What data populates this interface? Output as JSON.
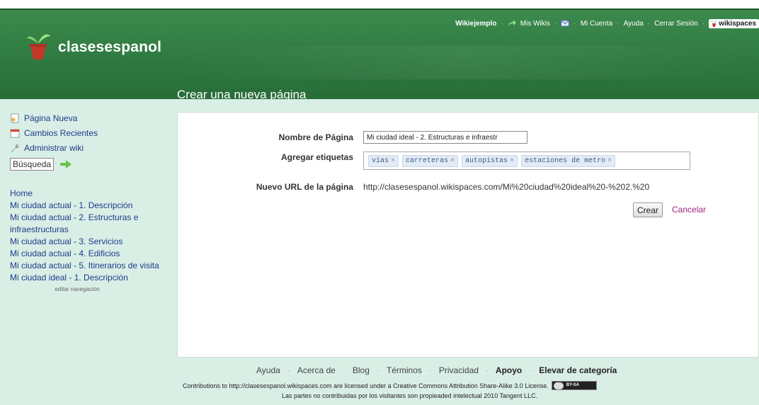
{
  "header": {
    "wiki_name": "clasesespanol",
    "page_title": "Crear una nueva página",
    "topnav": {
      "user": "Wikiejemplo",
      "my_wikis": "Mis Wikis",
      "my_account": "Mi Cuenta",
      "help": "Ayuda",
      "logout": "Cerrar Sesión",
      "brand": "wikispaces"
    },
    "colors": {
      "header_green": "#2f7a40",
      "band": "#d9efe6",
      "link_blue": "#1f3a8a",
      "cancel_purple": "#a0207e"
    }
  },
  "sidebar": {
    "new_page": "Página Nueva",
    "recent_changes": "Cambios Recientes",
    "manage_wiki": "Administrar wiki",
    "search_placeholder": "Búsqueda",
    "nav": [
      "Home",
      "Mi ciudad actual - 1. Descripción",
      "Mi ciudad actual - 2. Estructuras e infraestructuras",
      "Mi ciudad actual - 3. Servicios",
      "Mi ciudad actual - 4. Edificios",
      "Mi ciudad actual - 5. Itinerarios de visita",
      "Mi ciudad ideal - 1. Descripción"
    ],
    "edit_nav": "editar navegación"
  },
  "form": {
    "name_label": "Nombre de Página",
    "name_value": "Mi ciudad ideal - 2. Estructuras e infraestr",
    "tags_label": "Agregar etiquetas",
    "tags": [
      "vias",
      "carreteras",
      "autopistas",
      "estaciones de metro"
    ],
    "url_label": "Nuevo URL de la página",
    "url_value": "http://clasesespanol.wikispaces.com/Mi%20ciudad%20ideal%20-%202.%20",
    "create_label": "Crear",
    "cancel_label": "Cancelar"
  },
  "footer": {
    "links": [
      "Ayuda",
      "Acerca de",
      "Blog",
      "Términos",
      "Privacidad",
      "Apoyo",
      "Elevar de categoría"
    ],
    "license": "Contributions to http://clasesespanol.wikispaces.com are licensed under a Creative Commons Attribution Share-Alike 3.0 License.",
    "license_badge": "BY-SA",
    "ownership": "Las partes no contribuidas por los visitantes son propieaded intelectual 2010 Tangent LLC."
  }
}
